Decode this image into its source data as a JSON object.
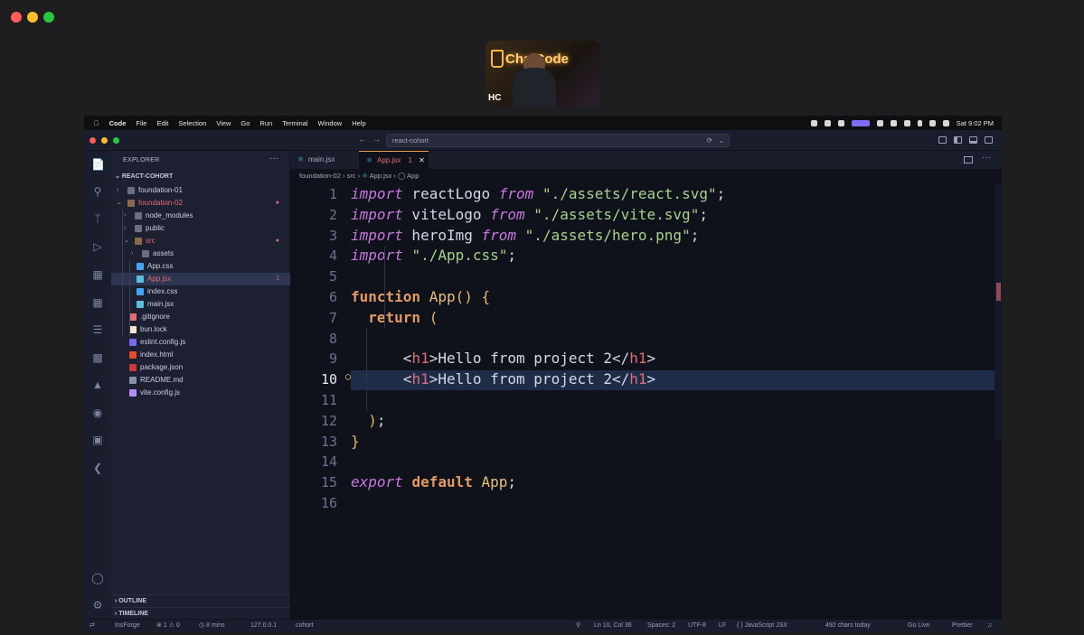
{
  "os": {
    "menubar": {
      "app": "Code",
      "items": [
        "File",
        "Edit",
        "Selection",
        "View",
        "Go",
        "Run",
        "Terminal",
        "Window",
        "Help"
      ],
      "clock": "Sat 9:02 PM"
    }
  },
  "webcam": {
    "initials": "HC",
    "sign": "ChaiCode"
  },
  "window": {
    "search_placeholder": "react-cohort"
  },
  "explorer": {
    "title": "EXPLORER",
    "more": "···",
    "project": "REACT-COHORT",
    "rows": [
      {
        "label": "foundation-01",
        "indent": 0,
        "kind": "folder",
        "open": false
      },
      {
        "label": "foundation-02",
        "indent": 0,
        "kind": "folder",
        "open": true,
        "modified": true,
        "badge": "●"
      },
      {
        "label": "node_modules",
        "indent": 1,
        "kind": "folder",
        "open": false
      },
      {
        "label": "public",
        "indent": 1,
        "kind": "folder",
        "open": false
      },
      {
        "label": "src",
        "indent": 1,
        "kind": "folder",
        "open": true,
        "modified": true,
        "badge": "●"
      },
      {
        "label": "assets",
        "indent": 2,
        "kind": "folder",
        "open": false
      },
      {
        "label": "App.css",
        "indent": 2,
        "kind": "css"
      },
      {
        "label": "App.jsx",
        "indent": 2,
        "kind": "react",
        "selected": true,
        "modified": true,
        "badge": "1"
      },
      {
        "label": "index.css",
        "indent": 2,
        "kind": "css"
      },
      {
        "label": "main.jsx",
        "indent": 2,
        "kind": "react"
      },
      {
        "label": ".gitignore",
        "indent": 1,
        "kind": "git"
      },
      {
        "label": "bun.lock",
        "indent": 1,
        "kind": "bun"
      },
      {
        "label": "eslint.config.js",
        "indent": 1,
        "kind": "eslint"
      },
      {
        "label": "index.html",
        "indent": 1,
        "kind": "html"
      },
      {
        "label": "package.json",
        "indent": 1,
        "kind": "npm"
      },
      {
        "label": "README.md",
        "indent": 1,
        "kind": "md"
      },
      {
        "label": "vite.config.js",
        "indent": 1,
        "kind": "vite"
      }
    ],
    "outline": "OUTLINE",
    "timeline": "TIMELINE"
  },
  "tabs": [
    {
      "label": "main.jsx",
      "active": false
    },
    {
      "label": "App.jsx",
      "active": true,
      "badge": "1",
      "close": "✕"
    }
  ],
  "breadcrumb": {
    "parts": [
      "foundation-02",
      "src",
      "App.jsx",
      "App"
    ],
    "sep": "›"
  },
  "code": {
    "current_line": 10,
    "lines": [
      [
        [
          "kw",
          "import"
        ],
        [
          "p",
          " reactLogo "
        ],
        [
          "kw",
          "from"
        ],
        [
          "p",
          " "
        ],
        [
          "str",
          "\"./assets/react.svg\""
        ],
        [
          "p",
          ";"
        ]
      ],
      [
        [
          "kw",
          "import"
        ],
        [
          "p",
          " viteLogo "
        ],
        [
          "kw",
          "from"
        ],
        [
          "p",
          " "
        ],
        [
          "str",
          "\"./assets/vite.svg\""
        ],
        [
          "p",
          ";"
        ]
      ],
      [
        [
          "kw",
          "import"
        ],
        [
          "p",
          " heroImg "
        ],
        [
          "kw",
          "from"
        ],
        [
          "p",
          " "
        ],
        [
          "str",
          "\"./assets/hero.png\""
        ],
        [
          "p",
          ";"
        ]
      ],
      [
        [
          "kw",
          "import"
        ],
        [
          "p",
          " "
        ],
        [
          "str",
          "\"./App.css\""
        ],
        [
          "p",
          ";"
        ]
      ],
      [],
      [
        [
          "kwb",
          "function"
        ],
        [
          "p",
          " "
        ],
        [
          "fn",
          "App"
        ],
        [
          "par",
          "()"
        ],
        [
          "p",
          " "
        ],
        [
          "par",
          "{"
        ]
      ],
      [
        [
          "p",
          "  "
        ],
        [
          "kwb",
          "return"
        ],
        [
          "p",
          " "
        ],
        [
          "par",
          "("
        ]
      ],
      [],
      [
        [
          "p",
          "      <"
        ],
        [
          "tag",
          "h1"
        ],
        [
          "p",
          ">Hello from project 2</"
        ],
        [
          "tag",
          "h1"
        ],
        [
          "p",
          ">"
        ]
      ],
      [
        [
          "p",
          "      <"
        ],
        [
          "tag",
          "h1"
        ],
        [
          "p",
          ">Hello from project 2</"
        ],
        [
          "tag",
          "h1"
        ],
        [
          "p",
          ">"
        ]
      ],
      [],
      [
        [
          "p",
          "  "
        ],
        [
          "par",
          ")"
        ],
        [
          "p",
          ";"
        ]
      ],
      [
        [
          "par",
          "}"
        ]
      ],
      [],
      [
        [
          "kw",
          "export"
        ],
        [
          "p",
          " "
        ],
        [
          "kwb",
          "default"
        ],
        [
          "p",
          " "
        ],
        [
          "fn",
          "App"
        ],
        [
          "p",
          ";"
        ]
      ],
      []
    ]
  },
  "status": {
    "branch_icon": "⇄",
    "insforge": "InsForge",
    "problems": "⊗ 1 ⚠ 0",
    "time": "◷ 8 mins",
    "host": "127.0.0.1",
    "project": "cohort",
    "position": "Ln 10, Col 36",
    "spaces": "Spaces: 2",
    "encoding": "UTF-8",
    "eol": "LF",
    "language": "{ } JavaScript JSX",
    "chars": "492 chars today",
    "golive": "Go Live",
    "prettier": "Prettier"
  },
  "colors": {
    "keyword": "#c678dd",
    "string": "#a8d18d",
    "tag": "#e06c75",
    "function": "#e8c07d",
    "modified": "#e06c75"
  }
}
